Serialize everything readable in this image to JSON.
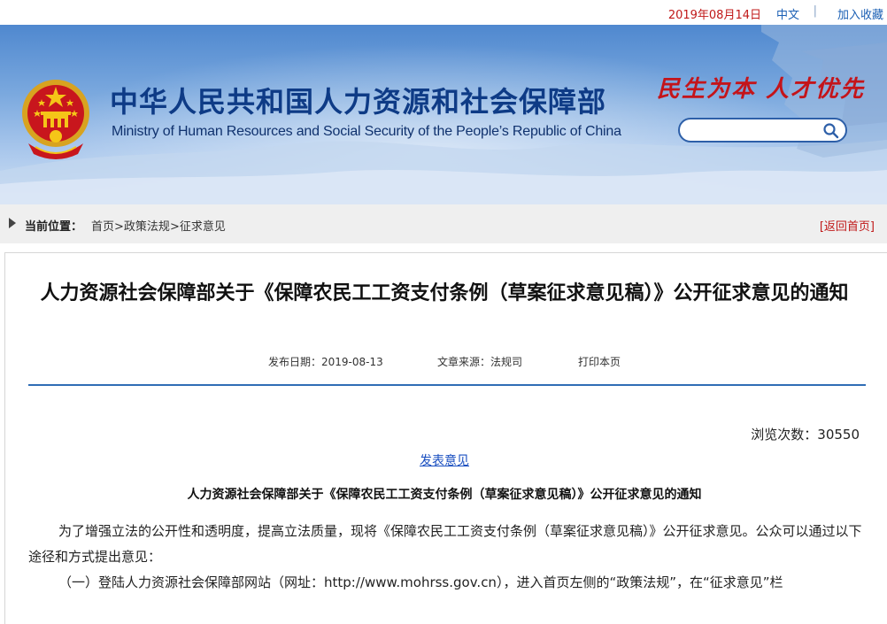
{
  "topbar": {
    "date": "2019年08月14日",
    "language": "中文",
    "separator": "|",
    "bookmark": "加入收藏"
  },
  "header": {
    "title_cn": "中华人民共和国人力资源和社会保障部",
    "title_en": "Ministry of Human Resources and Social Security of the People’s Republic of China",
    "slogan": "民生为本 人才优先",
    "search_placeholder": "",
    "colors": {
      "title": "#0e3b86",
      "slogan": "#c4141a",
      "banner_top": "#4f88cf"
    }
  },
  "breadcrumb": {
    "label": "当前位置：",
    "items": [
      "首页",
      "政策法规",
      "征求意见"
    ],
    "divider": ">",
    "back": "[返回首页]"
  },
  "article": {
    "title": "人力资源社会保障部关于《保障农民工工资支付条例（草案征求意见稿）》公开征求意见的通知",
    "publish_date": "发布日期：2019-08-13",
    "source": "文章来源：法规司",
    "print": "打印本页",
    "views": "浏览次数：30550",
    "comment_link": "发表意见",
    "subtitle": "人力资源社会保障部关于《保障农民工工资支付条例（草案征求意见稿）》公开征求意见的通知",
    "paragraphs": [
      "为了增强立法的公开性和透明度，提高立法质量，现将《保障农民工工资支付条例（草案征求意见稿）》公开征求意见。公众可以通过以下途径和方式提出意见：",
      "（一）登陆人力资源社会保障部网站（网址：http://www.mohrss.gov.cn），进入首页左侧的“政策法规”，在“征求意见”栏"
    ]
  }
}
